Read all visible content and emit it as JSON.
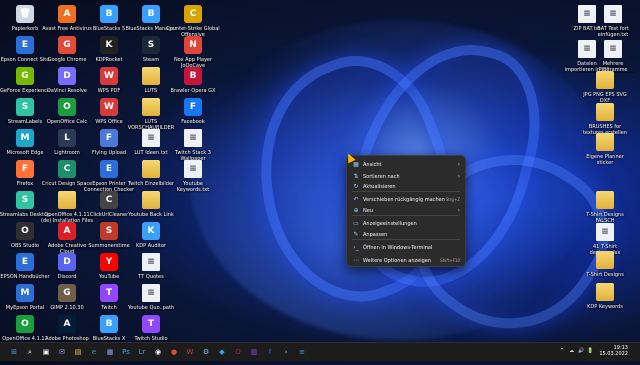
{
  "desktop": {
    "left_icons": [
      {
        "label": "Papierkorb",
        "kind": "bin",
        "color": "#cfd8e3"
      },
      {
        "label": "Avast Free Antivirus",
        "kind": "app",
        "color": "#f07020"
      },
      {
        "label": "BlueStacks 5",
        "kind": "app",
        "color": "#3aa0ff"
      },
      {
        "label": "BlueStacks Manager",
        "kind": "app",
        "color": "#3aa0ff"
      },
      {
        "label": "Counter-Strike Global Offensive",
        "kind": "app",
        "color": "#d9a400"
      },
      {
        "label": "Epson Connect Site",
        "kind": "app",
        "color": "#2b6fd6"
      },
      {
        "label": "Google Chrome",
        "kind": "app",
        "color": "#e24b3a"
      },
      {
        "label": "KDPRocket",
        "kind": "app",
        "color": "#222"
      },
      {
        "label": "Steam",
        "kind": "app",
        "color": "#1b2838"
      },
      {
        "label": "Nox App Player JoOoCave",
        "kind": "app",
        "color": "#e0453a"
      },
      {
        "label": "GeForce Experience",
        "kind": "app",
        "color": "#76b900"
      },
      {
        "label": "DaVinci Resolve",
        "kind": "app",
        "color": "#7a6bff"
      },
      {
        "label": "WPS PDF",
        "kind": "app",
        "color": "#d63a3a"
      },
      {
        "label": "LUTS",
        "kind": "folder",
        "color": "#f2c94c"
      },
      {
        "label": "Brawler Opera GX",
        "kind": "app",
        "color": "#c4153a"
      },
      {
        "label": "StreamLabels",
        "kind": "app",
        "color": "#31c3a2"
      },
      {
        "label": "OpenOffice Calc",
        "kind": "app",
        "color": "#1b9c3d"
      },
      {
        "label": "WPS Office",
        "kind": "app",
        "color": "#d63a3a"
      },
      {
        "label": "LUTS VORSCHAUBILDER",
        "kind": "folder",
        "color": "#f2c94c"
      },
      {
        "label": "Facebook",
        "kind": "app",
        "color": "#1877f2"
      },
      {
        "label": "Microsoft Edge",
        "kind": "app",
        "color": "#1fa6c9"
      },
      {
        "label": "Lightroom",
        "kind": "app",
        "color": "#2b3a55"
      },
      {
        "label": "Flying Upload",
        "kind": "app",
        "color": "#4a79d8"
      },
      {
        "label": "LUT Ideen.txt",
        "kind": "file",
        "color": "#eef1f6"
      },
      {
        "label": "Twitch Stack 3 Wallpaper",
        "kind": "file",
        "color": "#eef1f6"
      },
      {
        "label": "Firefox",
        "kind": "app",
        "color": "#ff7139"
      },
      {
        "label": "Cricut Design Space",
        "kind": "app",
        "color": "#1c8f6a"
      },
      {
        "label": "Epson Printer Connection Checker",
        "kind": "app",
        "color": "#2b6fd6"
      },
      {
        "label": "Twitch Einzelbilder",
        "kind": "folder",
        "color": "#f2c94c"
      },
      {
        "label": "Youtube Keywords.txt",
        "kind": "file",
        "color": "#eef1f6"
      },
      {
        "label": "Streamlabs Desktop",
        "kind": "app",
        "color": "#31c3a2"
      },
      {
        "label": "OpenOffice 4.1.11 (de) Installation Files",
        "kind": "folder",
        "color": "#f2c94c"
      },
      {
        "label": "ClickUrlCleaner",
        "kind": "app",
        "color": "#444"
      },
      {
        "label": "Youtube Back Link",
        "kind": "folder",
        "color": "#f2c94c"
      },
      {
        "label": "",
        "kind": "none",
        "color": ""
      },
      {
        "label": "OBS Studio",
        "kind": "app",
        "color": "#302e31"
      },
      {
        "label": "Adobe Creative Cloud",
        "kind": "app",
        "color": "#da1f26"
      },
      {
        "label": "Summonerstime",
        "kind": "app",
        "color": "#c0392b"
      },
      {
        "label": "KDP Auditor",
        "kind": "app",
        "color": "#3aa0ff"
      },
      {
        "label": "",
        "kind": "none",
        "color": ""
      },
      {
        "label": "EPSON Handbücher",
        "kind": "app",
        "color": "#2b6fd6"
      },
      {
        "label": "Discord",
        "kind": "app",
        "color": "#5865f2"
      },
      {
        "label": "YouTube",
        "kind": "app",
        "color": "#ff0000"
      },
      {
        "label": "TT Quotes",
        "kind": "file",
        "color": "#eef1f6"
      },
      {
        "label": "",
        "kind": "none",
        "color": ""
      },
      {
        "label": "MyEpson Portal",
        "kind": "app",
        "color": "#2b6fd6"
      },
      {
        "label": "GIMP 2.10.30",
        "kind": "app",
        "color": "#6f5e48"
      },
      {
        "label": "Twitch",
        "kind": "app",
        "color": "#9146ff"
      },
      {
        "label": "Youtube Quo..path",
        "kind": "file",
        "color": "#eef1f6"
      },
      {
        "label": "",
        "kind": "none",
        "color": ""
      },
      {
        "label": "OpenOffice 4.1.11",
        "kind": "app",
        "color": "#1b9c3d"
      },
      {
        "label": "Adobe Photoshop 2022",
        "kind": "app",
        "color": "#001e36"
      },
      {
        "label": "BlueStacks X",
        "kind": "app",
        "color": "#3aa0ff"
      },
      {
        "label": "Twitch Studio",
        "kind": "app",
        "color": "#9146ff"
      },
      {
        "label": "",
        "kind": "none",
        "color": ""
      }
    ],
    "right_icons": [
      {
        "label": "ZIP BAT.txt",
        "kind": "file"
      },
      {
        "label": "BAT Test fort einfügen.txt",
        "kind": "file"
      },
      {
        "label": "Dateien importieren in ZIP neu.txt",
        "kind": "file"
      },
      {
        "label": "Mehrere Programme öffnen Vorlage.txt",
        "kind": "file"
      },
      {
        "label": "JPG PNG EPS SVG DXF",
        "kind": "folder"
      },
      {
        "label": "BRUSHES for textures erstellen",
        "kind": "folder"
      },
      {
        "label": "Eigene Planner sticker",
        "kind": "folder"
      },
      {
        "label": "T-Shirt Designs FALSCH",
        "kind": "folder"
      },
      {
        "label": "41 T-Shirt designs.xlsx",
        "kind": "file"
      },
      {
        "label": "T-Shirt Designs",
        "kind": "folder"
      },
      {
        "label": "KDP Keywords",
        "kind": "folder"
      }
    ]
  },
  "context_menu": {
    "items": [
      {
        "label": "Ansicht",
        "icon": "grid-icon",
        "arrow": "›",
        "shortcut": ""
      },
      {
        "label": "Sortieren nach",
        "icon": "sort-icon",
        "arrow": "›",
        "shortcut": ""
      },
      {
        "label": "Aktualisieren",
        "icon": "refresh-icon",
        "arrow": "",
        "shortcut": ""
      },
      {
        "label": "Verschieben rückgängig machen",
        "icon": "undo-icon",
        "arrow": "",
        "shortcut": "Strg+Z"
      },
      {
        "label": "Neu",
        "icon": "new-icon",
        "arrow": "›",
        "shortcut": ""
      },
      {
        "label": "Anzeigeeinstellungen",
        "icon": "display-icon",
        "arrow": "",
        "shortcut": ""
      },
      {
        "label": "Anpassen",
        "icon": "brush-icon",
        "arrow": "",
        "shortcut": ""
      },
      {
        "label": "Öffnen in Windows-Terminal",
        "icon": "terminal-icon",
        "arrow": "",
        "shortcut": ""
      },
      {
        "label": "Weitere Optionen anzeigen",
        "icon": "more-icon",
        "arrow": "",
        "shortcut": "Shift+F10"
      }
    ]
  },
  "taskbar": {
    "clock_time": "19:13",
    "clock_date": "15.03.2022",
    "tray_icons": [
      "^",
      "☁",
      "🔊",
      "🔋"
    ],
    "apps": [
      {
        "name": "start-icon",
        "glyph": "⊞",
        "color": "#3aa0ff"
      },
      {
        "name": "search-icon",
        "glyph": "⌕",
        "color": "#ffffff"
      },
      {
        "name": "task-view-icon",
        "glyph": "▣",
        "color": "#ffffff"
      },
      {
        "name": "chat-icon",
        "glyph": "✉",
        "color": "#8aa0ff"
      },
      {
        "name": "explorer-icon",
        "glyph": "▤",
        "color": "#f2c94c"
      },
      {
        "name": "edge-icon",
        "glyph": "e",
        "color": "#1fa6c9"
      },
      {
        "name": "store-icon",
        "glyph": "▦",
        "color": "#8aa0ff"
      },
      {
        "name": "photoshop-icon",
        "glyph": "Ps",
        "color": "#31a8ff"
      },
      {
        "name": "lightroom-icon",
        "glyph": "Lr",
        "color": "#31a8ff"
      },
      {
        "name": "obs-icon",
        "glyph": "◉",
        "color": "#ffffff"
      },
      {
        "name": "chrome-icon",
        "glyph": "●",
        "color": "#e24b3a"
      },
      {
        "name": "wps-icon",
        "glyph": "W",
        "color": "#d63a3a"
      },
      {
        "name": "steam-icon",
        "glyph": "⚙",
        "color": "#66c0f4"
      },
      {
        "name": "bluestacks-icon",
        "glyph": "◆",
        "color": "#3aa0ff"
      },
      {
        "name": "opera-icon",
        "glyph": "O",
        "color": "#c4153a"
      },
      {
        "name": "twitch-icon",
        "glyph": "▥",
        "color": "#9146ff"
      },
      {
        "name": "facebook-icon",
        "glyph": "f",
        "color": "#1877f2"
      },
      {
        "name": "terminal-icon",
        "glyph": "›",
        "color": "#cccccc"
      },
      {
        "name": "notepad-icon",
        "glyph": "≡",
        "color": "#3aa0ff"
      }
    ]
  }
}
